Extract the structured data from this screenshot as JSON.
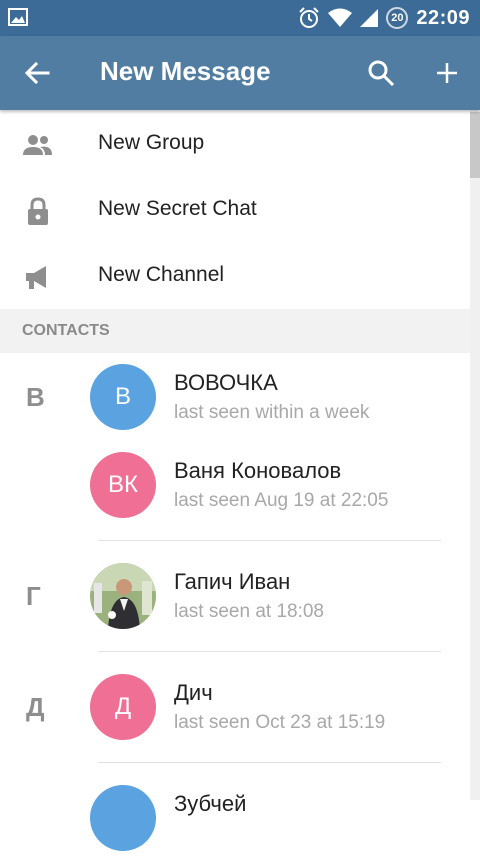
{
  "status_bar": {
    "time": "22:09",
    "battery_level": "20",
    "icons": [
      "gallery-icon",
      "alarm-icon",
      "wifi-icon",
      "signal-icon",
      "battery-icon"
    ]
  },
  "app_bar": {
    "title": "New Message",
    "icons": [
      "back-arrow-icon",
      "search-icon",
      "plus-icon"
    ]
  },
  "menu": {
    "items": [
      {
        "label": "New Group",
        "icon": "group-icon"
      },
      {
        "label": "New Secret Chat",
        "icon": "lock-icon"
      },
      {
        "label": "New Channel",
        "icon": "megaphone-icon"
      }
    ]
  },
  "section": {
    "header": "CONTACTS"
  },
  "contacts": {
    "letters": [
      "В",
      "Г",
      "Д"
    ],
    "items": [
      {
        "initials": "В",
        "name": "ВОВОЧКА",
        "status": "last seen within a week",
        "color": "#5ba2e0"
      },
      {
        "initials": "ВК",
        "name": "Ваня Коновалов",
        "status": "last seen Aug 19 at 22:05",
        "color": "#f06f94"
      },
      {
        "initials": "",
        "name": "Гапич Иван",
        "status": "last seen at 18:08",
        "color": "#7a9a6a"
      },
      {
        "initials": "Д",
        "name": "Дич",
        "status": "last seen Oct 23 at 15:19",
        "color": "#f06f94"
      },
      {
        "initials": "",
        "name": "Зубчей",
        "status": "",
        "color": "#5ba2e0"
      }
    ]
  },
  "colors": {
    "status_bar": "#3b6b96",
    "app_bar": "#517da2",
    "section_header_bg": "#f2f2f2"
  }
}
